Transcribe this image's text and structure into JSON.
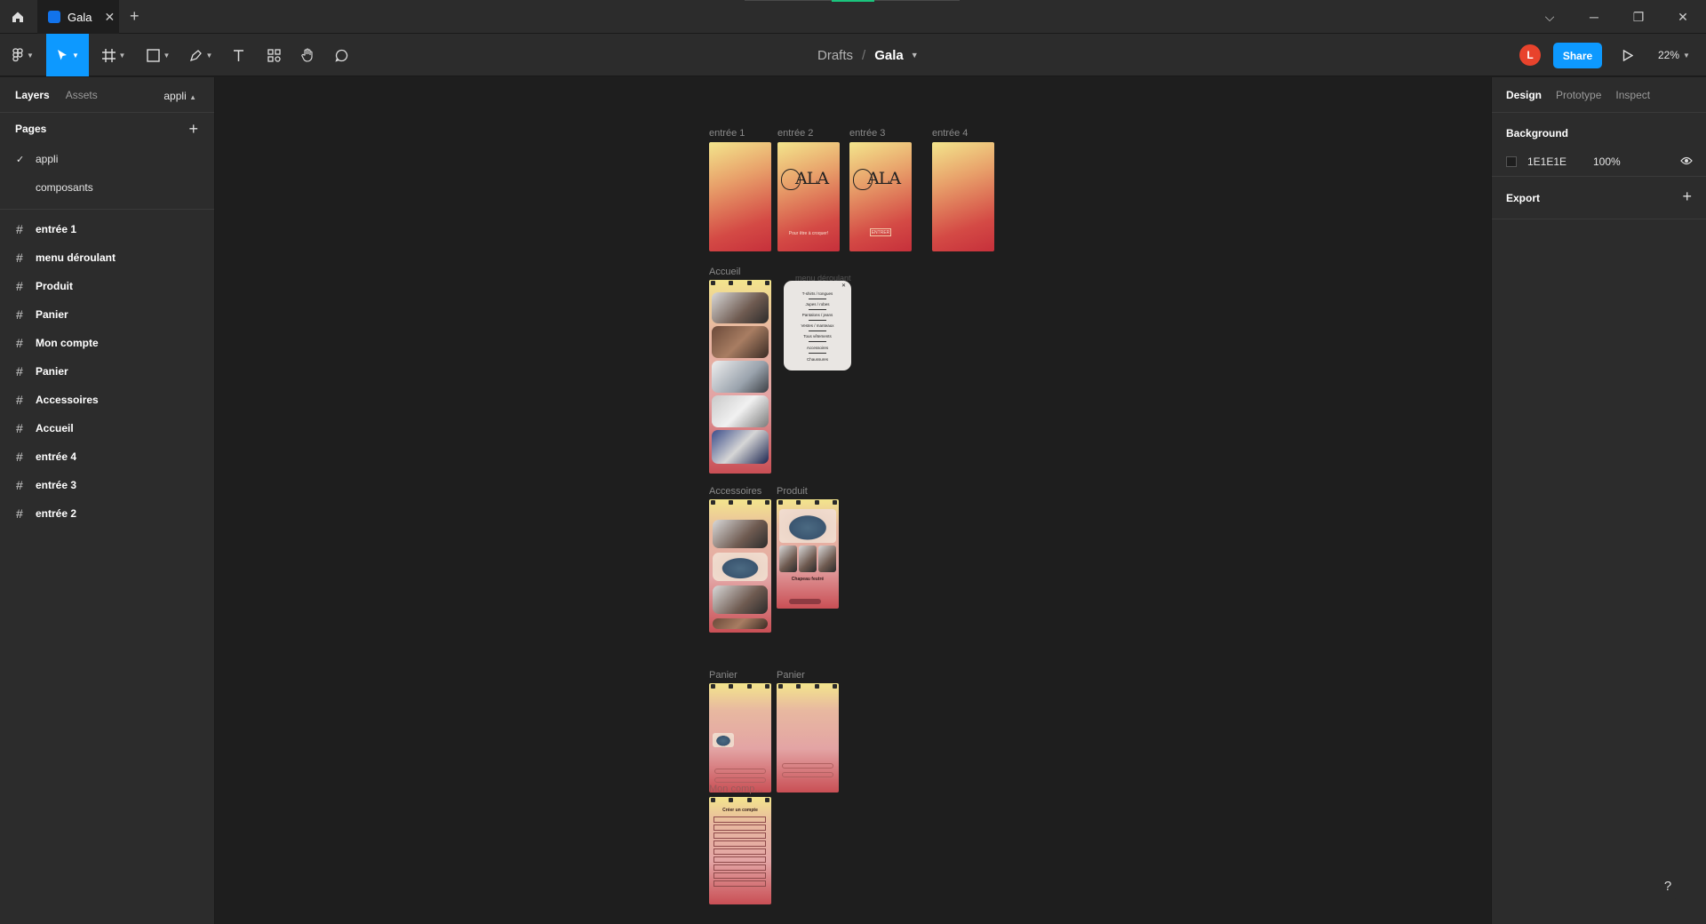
{
  "titlebar": {
    "tab_title": "Gala",
    "tab_close": "✕",
    "new_tab": "+",
    "controls": {
      "dropdown": "⌵",
      "minimize": "─",
      "restore": "❐",
      "close": "✕"
    }
  },
  "toolbar": {
    "breadcrumb_drafts": "Drafts",
    "breadcrumb_sep": "/",
    "file_name": "Gala",
    "avatar_initial": "L",
    "share_label": "Share",
    "zoom_label": "22%"
  },
  "left_panel": {
    "tabs": [
      "Layers",
      "Assets"
    ],
    "current_page_selector": "appli",
    "pages_heading": "Pages",
    "pages": [
      {
        "label": "appli",
        "selected": true
      },
      {
        "label": "composants",
        "selected": false
      }
    ],
    "layers": [
      "entrée 1",
      "menu déroulant",
      "Produit",
      "Panier",
      "Mon compte",
      "Panier",
      "Accessoires",
      "Accueil",
      "entrée 4",
      "entrée 3",
      "entrée 2"
    ]
  },
  "right_panel": {
    "tabs": [
      "Design",
      "Prototype",
      "Inspect"
    ],
    "background_heading": "Background",
    "background_hex": "1E1E1E",
    "background_opacity": "100%",
    "export_heading": "Export"
  },
  "help_label": "?",
  "canvas": {
    "frame_labels": {
      "entree1": "entrée 1",
      "entree2": "entrée 2",
      "entree3": "entrée 3",
      "entree4": "entrée 4",
      "accueil": "Accueil",
      "menu": "menu déroulant",
      "accessoires": "Accessoires",
      "produit": "Produit",
      "panier1": "Panier",
      "panier2": "Panier",
      "moncompte": "Mon comp..."
    },
    "entree2_logo": "ALA",
    "entree2_tagline": "Pour être à croquer!",
    "entree3_logo": "ALA",
    "entree3_button": "ENTRER",
    "menu_items": [
      "T-shirts / tongues",
      "Jupes / robes",
      "Pantalons / jeans",
      "Vestes / manteaux",
      "Tous vêtements",
      "Accessoires",
      "Chaussures"
    ],
    "produit_title": "Chapeau feutré",
    "moncompte_title": "Créer un compte",
    "colors": {
      "accent": "#0d99ff",
      "avatar": "#e8432c",
      "canvas": "#1E1E1E",
      "panel": "#2c2c2c"
    }
  }
}
